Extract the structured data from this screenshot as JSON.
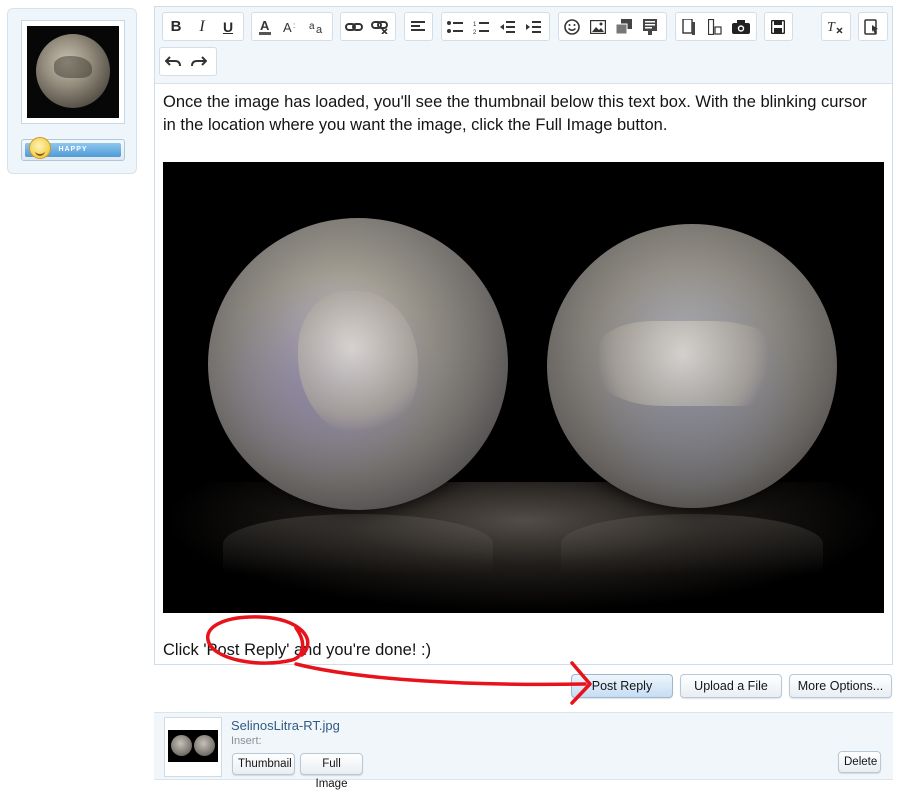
{
  "avatar": {
    "mood_label": "HAPPY"
  },
  "toolbar": {
    "groups": [
      [
        "bold-icon",
        "italic-icon",
        "underline-icon"
      ],
      [
        "text-color-icon",
        "font-size-icon",
        "font-family-icon"
      ],
      [
        "link-icon",
        "unlink-icon"
      ],
      [
        "align-icon"
      ],
      [
        "bullet-list-icon",
        "numbered-list-icon",
        "outdent-icon",
        "indent-icon"
      ],
      [
        "smilie-icon",
        "image-icon",
        "media-icon",
        "code-icon"
      ],
      [
        "quote-icon",
        "spoiler-icon",
        "camera-icon"
      ],
      [
        "save-draft-icon"
      ],
      [
        "remove-format-icon"
      ],
      [
        "toggle-bbcode-icon"
      ],
      [
        "undo-icon",
        "redo-icon"
      ]
    ],
    "labels": {
      "bold": "B",
      "italic": "I",
      "underline": "U"
    }
  },
  "content": {
    "paragraph1": "Once the image has loaded, you'll see the thumbnail below this text box.  With the blinking cursor in the location where you want the image, click the Full Image button.",
    "paragraph2": "Click 'Post Reply' and you're done! :)"
  },
  "actions": {
    "post_reply": "Post Reply",
    "upload_file": "Upload a File",
    "more_options": "More Options..."
  },
  "attachment": {
    "filename": "SelinosLitra-RT.jpg",
    "insert_label": "Insert:",
    "thumbnail_button": "Thumbnail",
    "full_image_button": "Full Image",
    "delete_button": "Delete"
  },
  "colors": {
    "accent_link": "#2f5b85",
    "annotation_red": "#e8121b",
    "toolbar_bg": "#f1f6fa"
  }
}
